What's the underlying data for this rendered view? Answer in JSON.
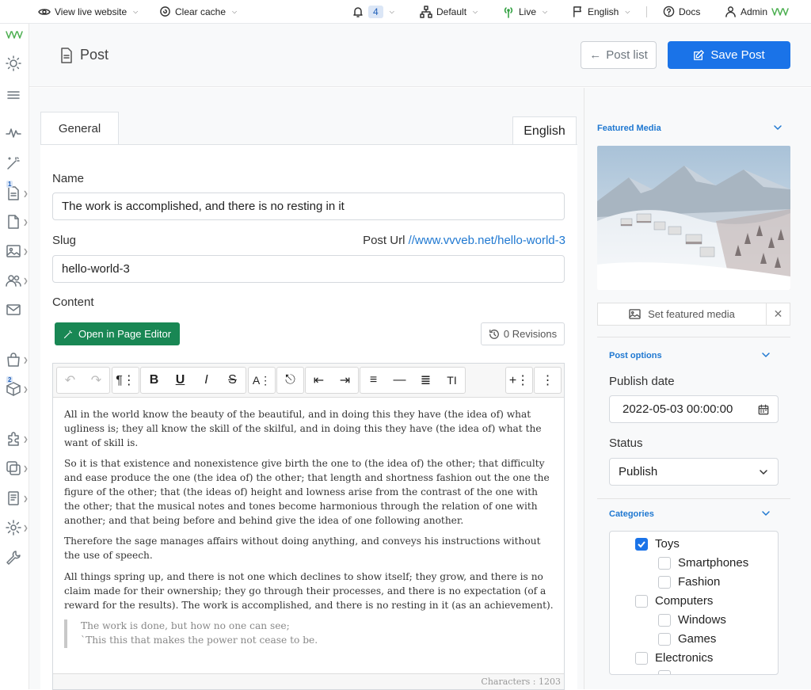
{
  "topbar": {
    "view_live": "View live website",
    "clear_cache": "Clear cache",
    "notifications_count": "4",
    "theme": "Default",
    "live": "Live",
    "language": "English",
    "docs": "Docs",
    "admin": "Admin"
  },
  "sidebar": {
    "badges": {
      "posts": "1",
      "products": "2"
    },
    "icons": [
      "logo-icon",
      "sun-icon",
      "menu-icon",
      "activity-icon",
      "magic-wand-icon",
      "posts-icon",
      "page-icon",
      "media-icon",
      "users-icon",
      "mail-icon",
      "shop-icon",
      "box-icon",
      "plugins-icon",
      "themes-icon",
      "forms-icon",
      "settings-icon",
      "tools-icon"
    ]
  },
  "header": {
    "title": "Post",
    "post_list": "Post list",
    "save": "Save Post"
  },
  "tabs": {
    "general": "General",
    "language": "English"
  },
  "form": {
    "name_label": "Name",
    "name_value": "The work is accomplished, and there is no resting in it",
    "slug_label": "Slug",
    "post_url_label": "Post Url",
    "post_url": "//www.vvveb.net/hello-world-3",
    "slug_value": "hello-world-3",
    "content_label": "Content",
    "open_editor": "Open in Page Editor",
    "revisions": "0 Revisions"
  },
  "editor": {
    "paragraphs": [
      "All in the world know the beauty of the beautiful, and in doing this they have (the idea of) what ugliness is; they all know the skill of the skilful, and in doing this they have (the idea of) what the want of skill is.",
      "So it is that existence and nonexistence give birth the one to (the idea of) the other; that difficulty and ease produce the one (the idea of) the other; that length and shortness fashion out the one the figure of the other; that (the ideas of) height and lowness arise from the contrast of the one with the other; that the musical notes and tones become harmonious through the relation of one with another; and that being before and behind give the idea of one following another.",
      "Therefore the sage manages affairs without doing anything, and conveys his instructions without the use of speech.",
      "All things spring up, and there is not one which declines to show itself; they grow, and there is no claim made for their ownership; they go through their processes, and there is no expectation (of a reward for the results). The work is accomplished, and there is no resting in it (as an achievement)."
    ],
    "quote_lines": [
      "The work is done, but how no one can see;",
      "`This this that makes the power not cease to be."
    ],
    "char_count": "Characters : 1203"
  },
  "right": {
    "featured_media": "Featured Media",
    "set_featured": "Set featured media",
    "post_options": "Post options",
    "publish_date_label": "Publish date",
    "publish_date": "2022-05-03 00:00:00",
    "status_label": "Status",
    "status": "Publish",
    "categories_label": "Categories",
    "categories": [
      {
        "name": "Toys",
        "checked": true,
        "level": 0
      },
      {
        "name": "Smartphones",
        "checked": false,
        "level": 1
      },
      {
        "name": "Fashion",
        "checked": false,
        "level": 1
      },
      {
        "name": "Computers",
        "checked": false,
        "level": 0
      },
      {
        "name": "Windows",
        "checked": false,
        "level": 1
      },
      {
        "name": "Games",
        "checked": false,
        "level": 1
      },
      {
        "name": "Electronics",
        "checked": false,
        "level": 0
      }
    ]
  },
  "colors": {
    "primary": "#1a73e8",
    "success": "#198754",
    "link": "#1f78d1"
  }
}
